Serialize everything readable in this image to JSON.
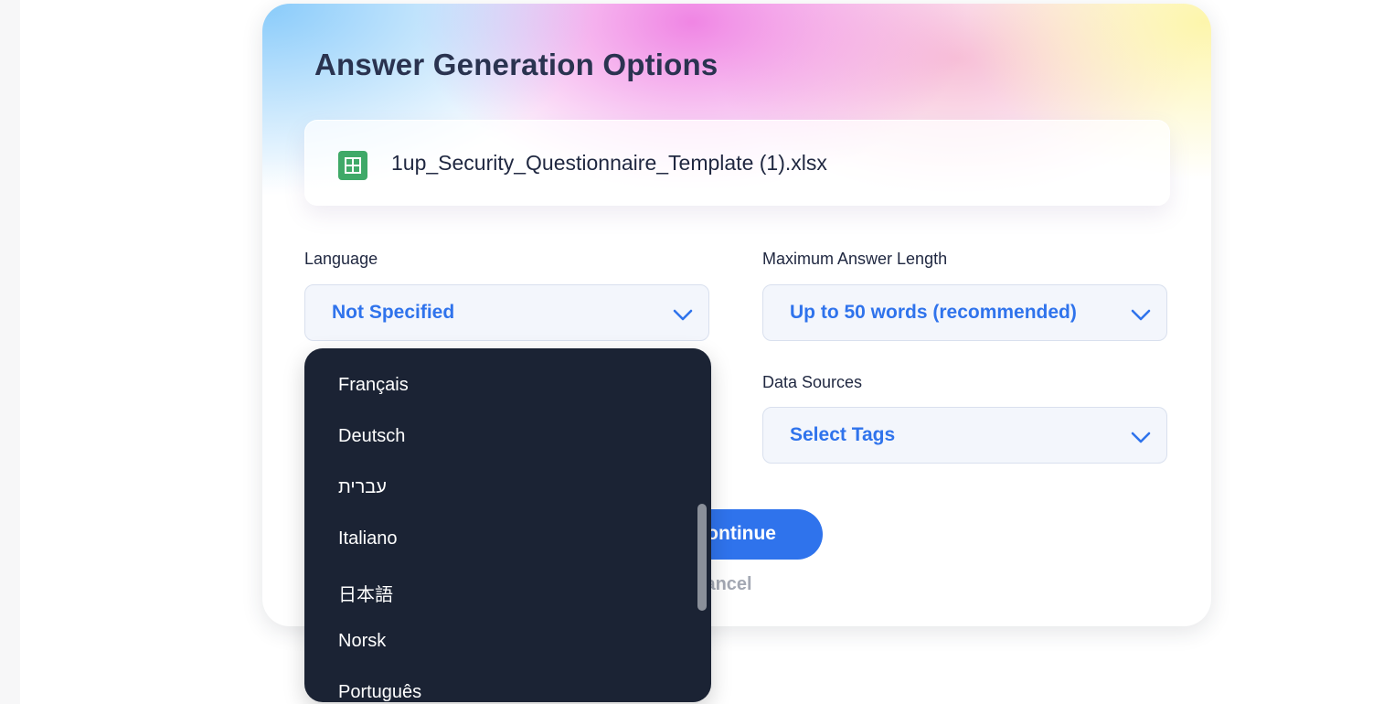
{
  "modal": {
    "title": "Answer Generation Options",
    "file": {
      "name": "1up_Security_Questionnaire_Template (1).xlsx",
      "icon": "spreadsheet-icon",
      "icon_color": "#3fa968"
    }
  },
  "language": {
    "label": "Language",
    "value": "Not Specified",
    "options": [
      "Français",
      "Deutsch",
      "עברית",
      "Italiano",
      "日本語",
      "Norsk",
      "Português"
    ]
  },
  "max_length": {
    "label": "Maximum Answer Length",
    "value": "Up to 50 words (recommended)"
  },
  "data_sources": {
    "label": "Data Sources",
    "value": "Select Tags"
  },
  "actions": {
    "continue_label": "Continue",
    "cancel_label": "Cancel"
  },
  "colors": {
    "accent": "#2f73ec",
    "title": "#2a3350",
    "dropdown_bg": "#1b2334"
  }
}
